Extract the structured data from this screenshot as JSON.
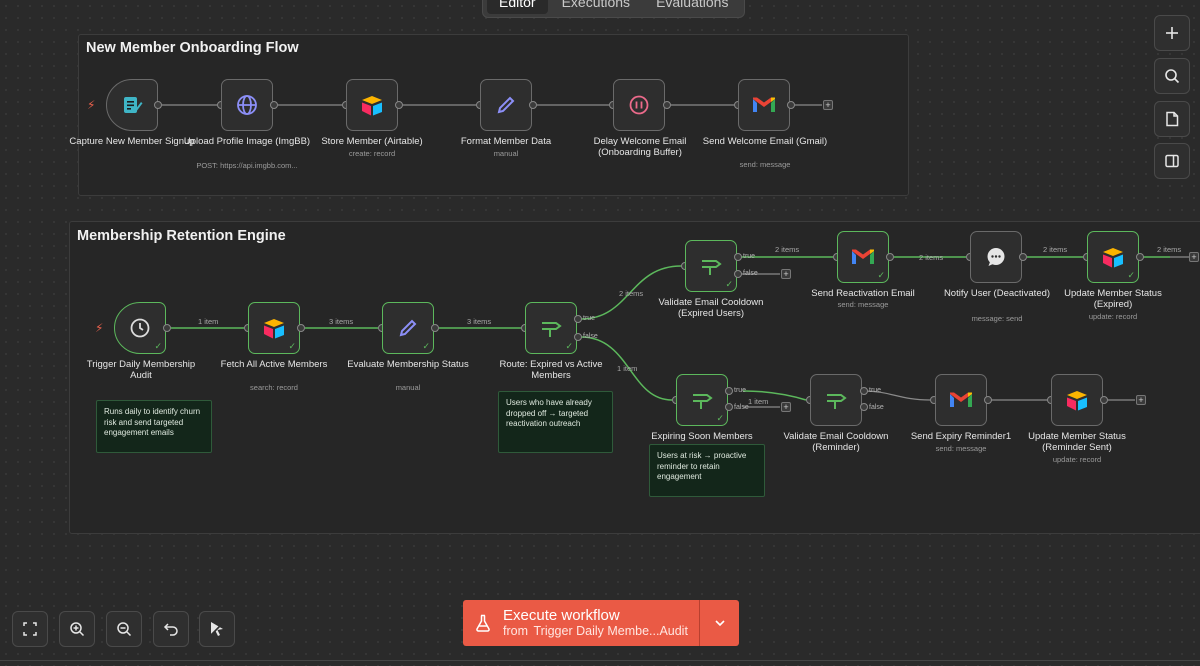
{
  "tabs": [
    {
      "label": "Editor",
      "active": true
    },
    {
      "label": "Executions",
      "active": false
    },
    {
      "label": "Evaluations",
      "active": false
    }
  ],
  "groups": {
    "onboarding": {
      "title": "New Member Onboarding Flow"
    },
    "retention": {
      "title": "Membership Retention Engine"
    }
  },
  "nodes": {
    "capture_signup": {
      "label": "Capture New Member Signup",
      "sub": ""
    },
    "upload_image": {
      "label": "Upload Profile Image (ImgBB)",
      "sub": "POST: https://api.imgbb.com..."
    },
    "store_member": {
      "label": "Store Member (Airtable)",
      "sub": "create: record"
    },
    "format_data": {
      "label": "Format Member Data",
      "sub": "manual"
    },
    "delay_welcome": {
      "label": "Delay Welcome Email (Onboarding Buffer)",
      "sub": ""
    },
    "send_welcome": {
      "label": "Send Welcome Email (Gmail)",
      "sub": "send: message"
    },
    "trigger_audit": {
      "label": "Trigger Daily Membership Audit",
      "sub": ""
    },
    "fetch_active": {
      "label": "Fetch All Active Members",
      "sub": "search: record"
    },
    "evaluate_status": {
      "label": "Evaluate Membership Status",
      "sub": "manual"
    },
    "route": {
      "label": "Route: Expired vs Active Members",
      "sub": ""
    },
    "validate_expired": {
      "label": "Validate Email Cooldown (Expired Users)",
      "sub": ""
    },
    "send_reactivation": {
      "label": "Send Reactivation Email",
      "sub": "send: message"
    },
    "notify_user": {
      "label": "Notify User (Deactivated)",
      "sub": "message: send"
    },
    "update_expired": {
      "label": "Update Member Status (Expired)",
      "sub": "update: record"
    },
    "expiring_soon": {
      "label": "Expiring Soon Members",
      "sub": ""
    },
    "validate_reminder": {
      "label": "Validate Email Cooldown (Reminder)",
      "sub": ""
    },
    "send_expiry": {
      "label": "Send Expiry Reminder1",
      "sub": "send: message"
    },
    "update_reminder": {
      "label": "Update Member Status (Reminder Sent)",
      "sub": "update: record"
    }
  },
  "edges": {
    "one_item_a": "1 item",
    "three_items_a": "3 items",
    "three_items_b": "3 items",
    "two_items_a": "2 items",
    "two_items_b": "2 items",
    "two_items_c": "2 items",
    "two_items_d": "2 items",
    "two_items_e": "2 items",
    "one_item_b": "1 item",
    "one_item_c": "1 item",
    "true": "true",
    "false": "false"
  },
  "notes": {
    "audit_note": "Runs daily to identify churn risk and send targeted engagement emails",
    "route_note": "Users who have already dropped off → targeted reactivation outreach",
    "expiring_note": "Users at risk → proactive reminder to retain engagement"
  },
  "execute": {
    "title": "Execute workflow",
    "from_prefix": "from",
    "from_node": "Trigger Daily Membe...Audit"
  },
  "icons": {
    "right_toolbar": [
      "plus-icon",
      "search-icon",
      "sticky-note-icon",
      "sidebar-panel-icon"
    ],
    "bottom_toolbar": [
      "fit-view-icon",
      "zoom-in-icon",
      "zoom-out-icon",
      "undo-icon",
      "clear-execution-icon"
    ]
  },
  "colors": {
    "success": "#5cb85c",
    "execute": "#ea5a45",
    "trigger_bolt": "#e8604c"
  }
}
